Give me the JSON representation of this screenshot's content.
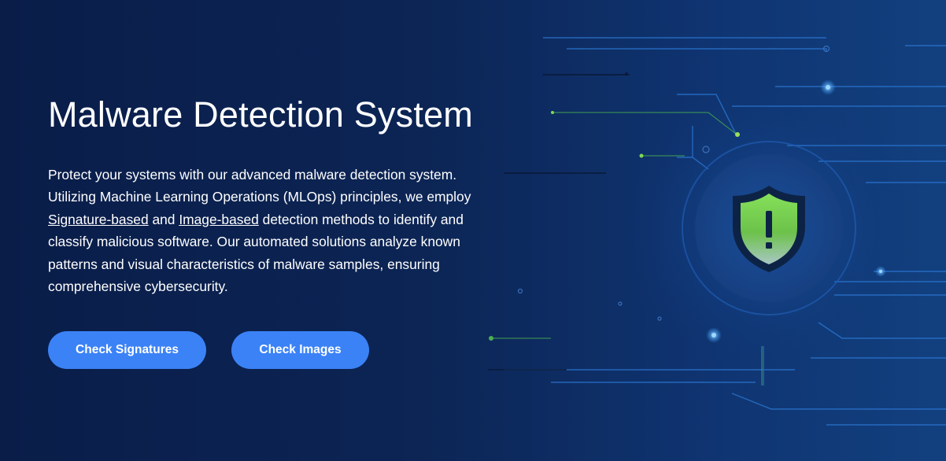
{
  "hero": {
    "title": "Malware Detection System",
    "description": {
      "line1": "Protect your systems with our advanced malware detection system. Utilizing Machine Learning Operations (MLOps) principles, we employ ",
      "link1": "Signature-based",
      "and": " and ",
      "link2": "Image-based",
      "line2": " detection methods to identify and classify malicious software. Our automated solutions analyze known patterns and visual characteristics of malware samples, ensuring comprehensive cybersecurity."
    },
    "buttons": {
      "check_signatures": "Check Signatures",
      "check_images": "Check Images"
    }
  },
  "illustration": {
    "icon": "shield-warning-icon",
    "shield_mark": "!"
  },
  "colors": {
    "background": "#0b1f4a",
    "button": "#3b82f6",
    "shield_green": "#7ed957",
    "circuit_blue": "#3aa0ff"
  }
}
